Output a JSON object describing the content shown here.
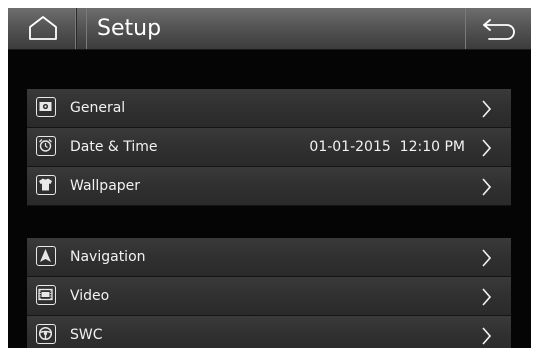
{
  "header": {
    "title": "Setup",
    "home_icon": "home-icon",
    "back_icon": "back-arrow-icon"
  },
  "groups": [
    {
      "items": [
        {
          "label": "General",
          "icon": "gear-icon",
          "value": ""
        },
        {
          "label": "Date & Time",
          "icon": "alarm-clock-icon",
          "value": "01-01-2015  12:10 PM"
        },
        {
          "label": "Wallpaper",
          "icon": "tshirt-icon",
          "value": ""
        }
      ]
    },
    {
      "items": [
        {
          "label": "Navigation",
          "icon": "navigation-arrow-icon",
          "value": ""
        },
        {
          "label": "Video",
          "icon": "film-icon",
          "value": ""
        },
        {
          "label": "SWC",
          "icon": "steering-wheel-icon",
          "value": ""
        }
      ]
    }
  ],
  "colors": {
    "background": "#050505",
    "header": "#555555",
    "row": "#303030",
    "text": "#f2f2f2"
  }
}
